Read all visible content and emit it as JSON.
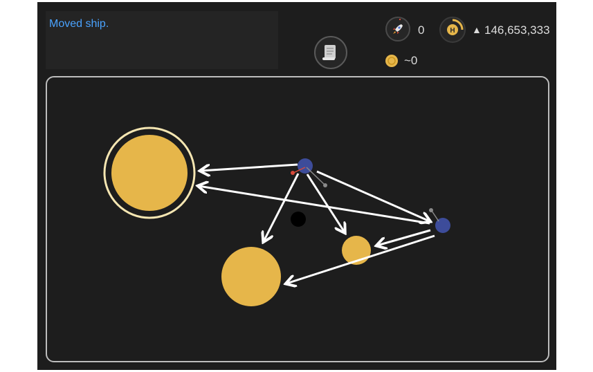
{
  "log": {
    "message": "Moved ship."
  },
  "hud": {
    "ships": "0",
    "credits": "146,653,333",
    "credits_prefix": "▲",
    "coins": "~0"
  },
  "colors": {
    "app_bg": "#1d1d1d",
    "log_text": "#4aa3ff",
    "planet": "#e6b64a",
    "ship": "#3d4c9a",
    "arrow": "#ffffff",
    "ring": "#f5e6b2"
  },
  "icons": [
    "rocket-icon",
    "hat-coin-icon",
    "scroll-icon",
    "coin-icon"
  ]
}
